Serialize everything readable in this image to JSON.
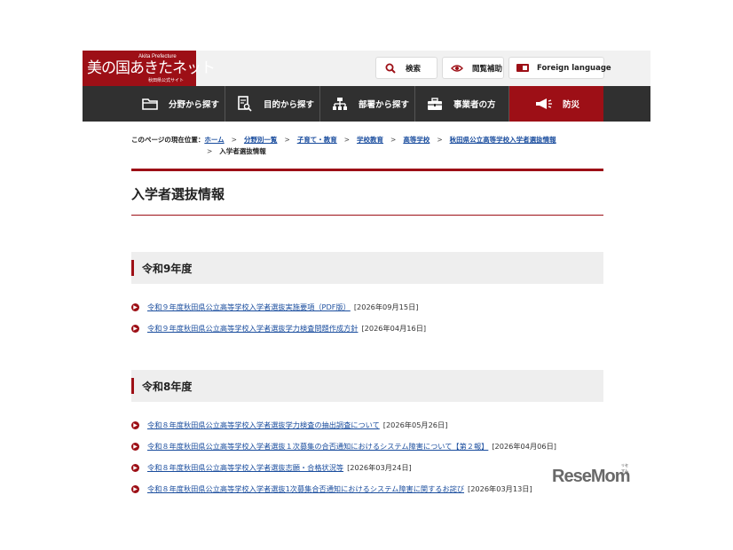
{
  "header": {
    "logo_main": "美の国あきたネット",
    "logo_sub": "Akita Prefecture",
    "logo_site": "秋田県公式サイト",
    "buttons": [
      {
        "label": "検索",
        "icon": "search-icon"
      },
      {
        "label": "閲覧補助",
        "icon": "eye-icon"
      },
      {
        "label": "Foreign language",
        "icon": "language-icon"
      }
    ]
  },
  "nav": [
    {
      "label": "分野から探す",
      "icon": "folder-icon"
    },
    {
      "label": "目的から探す",
      "icon": "document-search-icon"
    },
    {
      "label": "部署から探す",
      "icon": "org-chart-icon"
    },
    {
      "label": "事業者の方",
      "icon": "briefcase-icon"
    },
    {
      "label": "防災",
      "icon": "megaphone-icon"
    }
  ],
  "breadcrumb": {
    "label": "このページの現在位置：",
    "items": [
      "ホーム",
      "分野別一覧",
      "子育て・教育",
      "学校教育",
      "高等学校",
      "秋田県公立高等学校入学者選抜情報"
    ],
    "current": "入学者選抜情報"
  },
  "page_title": "入学者選抜情報",
  "sections": [
    {
      "title": "令和9年度",
      "items": [
        {
          "text": "令和９年度秋田県公立高等学校入学者選抜実施要項（PDF版）",
          "date": "[2026年09月15日]"
        },
        {
          "text": "令和９年度秋田県公立高等学校入学者選抜学力検査問題作成方針",
          "date": "[2026年04月16日]"
        }
      ]
    },
    {
      "title": "令和8年度",
      "items": [
        {
          "text": "令和８年度秋田県公立高等学校入学者選抜学力検査の抽出調査について",
          "date": "[2026年05月26日]"
        },
        {
          "text": "令和８年度秋田県公立高等学校入学者選抜１次募集の合否通知におけるシステム障害について【第２報】",
          "date": "[2026年04月06日]"
        },
        {
          "text": "令和８年度秋田県公立高等学校入学者選抜志願・合格状況等",
          "date": "[2026年03月24日]"
        },
        {
          "text": "令和８年度秋田県公立高等学校入学者選抜1次募集合否通知におけるシステム障害に関するお詫び",
          "date": "[2026年03月13日]"
        }
      ]
    }
  ],
  "watermark": {
    "text": "ReseMom",
    "small": "リセマム"
  },
  "colors": {
    "brand": "#9d0f16",
    "nav_bg": "#303030",
    "link": "#1a4d9e",
    "section_bg": "#eeeeee"
  }
}
